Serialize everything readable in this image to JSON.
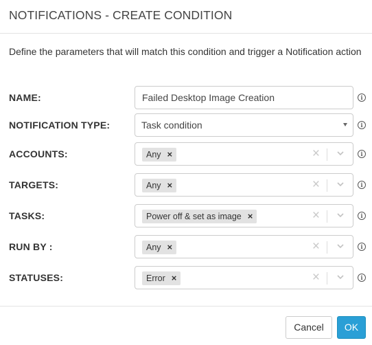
{
  "dialog": {
    "title": "NOTIFICATIONS - CREATE CONDITION",
    "description": "Define the parameters that will match this condition and trigger a Notification action"
  },
  "form": {
    "name": {
      "label": "NAME:",
      "value": "Failed Desktop Image Creation"
    },
    "notification_type": {
      "label": "NOTIFICATION TYPE:",
      "value": "Task condition"
    },
    "accounts": {
      "label": "ACCOUNTS:",
      "chips": [
        "Any"
      ]
    },
    "targets": {
      "label": "TARGETS:",
      "chips": [
        "Any"
      ]
    },
    "tasks": {
      "label": "TASKS:",
      "chips": [
        "Power off & set as image"
      ]
    },
    "run_by": {
      "label": "RUN BY :",
      "chips": [
        "Any"
      ]
    },
    "statuses": {
      "label": "STATUSES:",
      "chips": [
        "Error"
      ]
    }
  },
  "icons": {
    "info": "i",
    "chip_remove": "×",
    "clear": "×"
  },
  "footer": {
    "cancel_label": "Cancel",
    "ok_label": "OK"
  },
  "colors": {
    "primary": "#2a9fd6",
    "chip_bg": "#e2e2e2"
  }
}
